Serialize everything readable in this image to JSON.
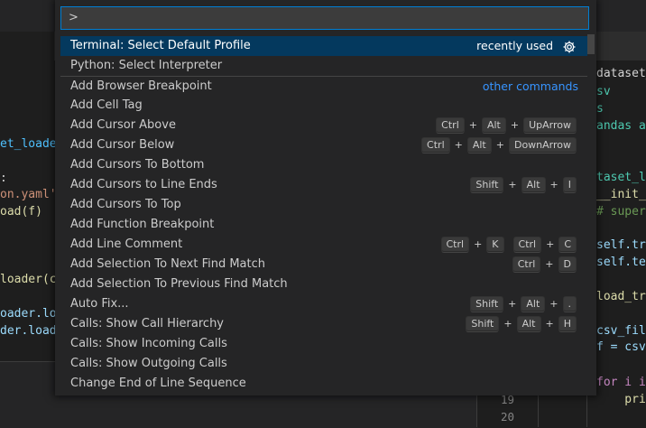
{
  "palette": {
    "input_value": ">",
    "selected_tag": "recently used",
    "other_tag": "other commands",
    "commands": [
      {
        "label": "Terminal: Select Default Profile",
        "keys": []
      },
      {
        "label": "Python: Select Interpreter",
        "keys": []
      },
      {
        "label": "Add Browser Breakpoint",
        "keys": []
      },
      {
        "label": "Add Cell Tag",
        "keys": []
      },
      {
        "label": "Add Cursor Above",
        "keys": [
          [
            "Ctrl",
            "Alt",
            "UpArrow"
          ]
        ]
      },
      {
        "label": "Add Cursor Below",
        "keys": [
          [
            "Ctrl",
            "Alt",
            "DownArrow"
          ]
        ]
      },
      {
        "label": "Add Cursors To Bottom",
        "keys": []
      },
      {
        "label": "Add Cursors to Line Ends",
        "keys": [
          [
            "Shift",
            "Alt",
            "I"
          ]
        ]
      },
      {
        "label": "Add Cursors To Top",
        "keys": []
      },
      {
        "label": "Add Function Breakpoint",
        "keys": []
      },
      {
        "label": "Add Line Comment",
        "keys": [
          [
            "Ctrl",
            "K"
          ],
          [
            "Ctrl",
            "C"
          ]
        ]
      },
      {
        "label": "Add Selection To Next Find Match",
        "keys": [
          [
            "Ctrl",
            "D"
          ]
        ]
      },
      {
        "label": "Add Selection To Previous Find Match",
        "keys": []
      },
      {
        "label": "Auto Fix...",
        "keys": [
          [
            "Shift",
            "Alt",
            "."
          ]
        ]
      },
      {
        "label": "Calls: Show Call Hierarchy",
        "keys": [
          [
            "Shift",
            "Alt",
            "H"
          ]
        ]
      },
      {
        "label": "Calls: Show Incoming Calls",
        "keys": []
      },
      {
        "label": "Calls: Show Outgoing Calls",
        "keys": []
      },
      {
        "label": "Change End of Line Sequence",
        "keys": []
      }
    ]
  },
  "editor_left": {
    "lines": [
      "et_loader",
      ":",
      "on.yaml')",
      "oad(f)",
      "loader(cf",
      "oader.loa",
      "der.load"
    ]
  },
  "editor_right": {
    "lines": [
      "dataset_lo",
      "sv",
      "s",
      "andas as",
      "taset_lo",
      "__init__",
      "# super(",
      "self.tra",
      "self.tes",
      "load_tra",
      "csv_file",
      "f = csv.",
      "for i in",
      "    prin"
    ]
  },
  "gutter": {
    "numbers": [
      "19",
      "20"
    ]
  },
  "colors": {
    "accent": "#007fd4",
    "selected_row": "#04395e",
    "link": "#3794ff"
  },
  "icons": {
    "configure": "gear-icon"
  }
}
